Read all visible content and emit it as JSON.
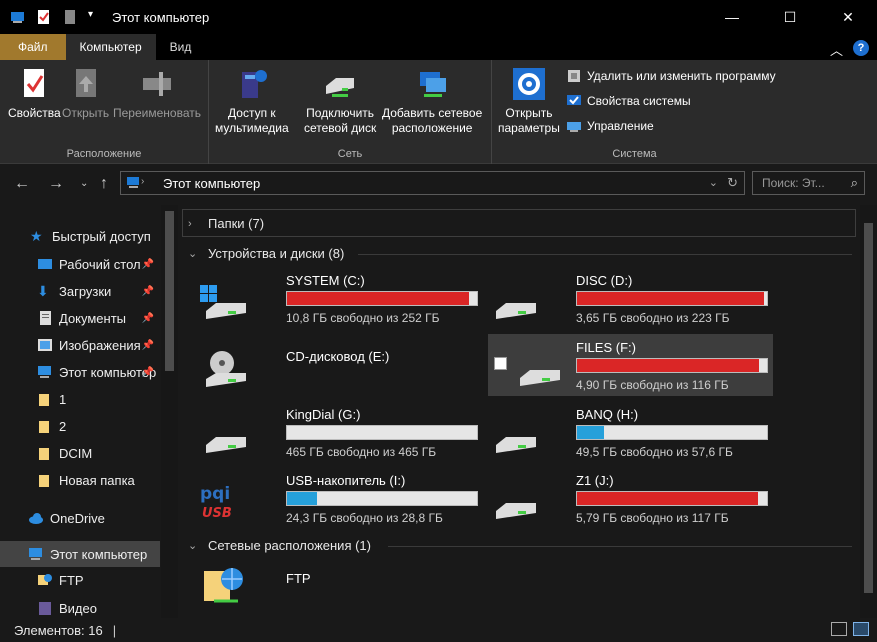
{
  "window": {
    "title": "Этот компьютер",
    "minimize": "—",
    "maximize": "☐",
    "close": "✕"
  },
  "ribbon_tabs": [
    {
      "label": "Файл"
    },
    {
      "label": "Компьютер"
    },
    {
      "label": "Вид"
    }
  ],
  "ribbon": {
    "groups": {
      "location": "Расположение",
      "network": "Сеть",
      "system": "Система"
    },
    "buttons": {
      "properties": "Свойства",
      "open": "Открыть",
      "rename": "Переименовать",
      "media_line1": "Доступ к",
      "media_line2": "мультимедиа",
      "mapdrive_line1": "Подключить",
      "mapdrive_line2": "сетевой диск",
      "addnet_line1": "Добавить сетевое",
      "addnet_line2": "расположение",
      "settings_line1": "Открыть",
      "settings_line2": "параметры",
      "uninstall": "Удалить или изменить программу",
      "sysprops": "Свойства системы",
      "manage": "Управление"
    }
  },
  "address": {
    "path": "Этот компьютер",
    "search_placeholder": "Поиск: Эт..."
  },
  "nav": {
    "quick_access": "Быстрый доступ",
    "items": [
      {
        "label": "Рабочий стол"
      },
      {
        "label": "Загрузки"
      },
      {
        "label": "Документы"
      },
      {
        "label": "Изображения"
      },
      {
        "label": "Этот компьютер"
      },
      {
        "label": "1"
      },
      {
        "label": "2"
      },
      {
        "label": "DCIM"
      },
      {
        "label": "Новая папка"
      }
    ],
    "onedrive": "OneDrive",
    "this_pc": "Этот компьютер",
    "ftp": "FTP",
    "video": "Видео"
  },
  "sections": {
    "folders": "Папки (7)",
    "devices": "Устройства и диски (8)",
    "network": "Сетевые расположения (1)"
  },
  "drives": [
    {
      "name": "SYSTEM (C:)",
      "free": "10,8 ГБ свободно из 252 ГБ",
      "used_fraction": 0.957,
      "color": "#da2626"
    },
    {
      "name": "DISC (D:)",
      "free": "3,65 ГБ свободно из 223 ГБ",
      "used_fraction": 0.984,
      "color": "#da2626"
    },
    {
      "name": "CD-дисковод (E:)",
      "free": "",
      "used_fraction": 0,
      "color": "#da2626"
    },
    {
      "name": "FILES (F:)",
      "free": "4,90 ГБ свободно из 116 ГБ",
      "used_fraction": 0.958,
      "color": "#da2626"
    },
    {
      "name": "KingDial (G:)",
      "free": "465 ГБ свободно из 465 ГБ",
      "used_fraction": 0.0,
      "color": "#26a0da"
    },
    {
      "name": "BANQ (H:)",
      "free": "49,5 ГБ свободно из 57,6 ГБ",
      "used_fraction": 0.14,
      "color": "#26a0da"
    },
    {
      "name": "USB-накопитель (I:)",
      "free": "24,3 ГБ свободно из 28,8 ГБ",
      "used_fraction": 0.156,
      "color": "#26a0da"
    },
    {
      "name": "Z1 (J:)",
      "free": "5,79 ГБ свободно из 117 ГБ",
      "used_fraction": 0.95,
      "color": "#da2626"
    }
  ],
  "network_locations": [
    {
      "name": "FTP"
    }
  ],
  "status": {
    "items": "Элементов: 16"
  }
}
